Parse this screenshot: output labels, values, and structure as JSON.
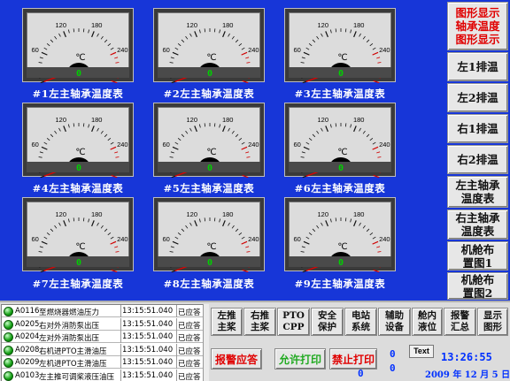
{
  "gauges": [
    {
      "label": "#1左主轴承温度表",
      "value": "0",
      "unit": "℃"
    },
    {
      "label": "#2左主轴承温度表",
      "value": "0",
      "unit": "℃"
    },
    {
      "label": "#3左主轴承温度表",
      "value": "0",
      "unit": "℃"
    },
    {
      "label": "#4左主轴承温度表",
      "value": "0",
      "unit": "℃"
    },
    {
      "label": "#5左主轴承温度表",
      "value": "0",
      "unit": "℃"
    },
    {
      "label": "#6左主轴承温度表",
      "value": "0",
      "unit": "℃"
    },
    {
      "label": "#7左主轴承温度表",
      "value": "0",
      "unit": "℃"
    },
    {
      "label": "#8左主轴承温度表",
      "value": "0",
      "unit": "℃"
    },
    {
      "label": "#9左主轴承温度表",
      "value": "0",
      "unit": "℃"
    }
  ],
  "gauge_scale": {
    "min": 0,
    "max": 300,
    "ticks": [
      "0",
      "60",
      "120",
      "180",
      "240",
      "300"
    ]
  },
  "nav": {
    "title_line1": "图形显示",
    "title_line2": "轴承温度",
    "title_line3": "图形显示",
    "items": [
      "左1排温",
      "左2排温",
      "右1排温",
      "右2排温",
      "左主轴承温度表",
      "右主轴承温度表",
      "机舱布置图1",
      "机舱布置图2"
    ]
  },
  "alarms": [
    {
      "code": "A0116",
      "desc": "至燃烧器燃油压力",
      "time": "13:15:51.040",
      "ack": "已应答"
    },
    {
      "code": "A0205",
      "desc": "右对外消防泵出压",
      "time": "13:15:51.040",
      "ack": "已应答"
    },
    {
      "code": "A0204",
      "desc": "左对外消防泵出压",
      "time": "13:15:51.040",
      "ack": "已应答"
    },
    {
      "code": "A0208",
      "desc": "右机进PTO主滑油压",
      "time": "13:15:51.040",
      "ack": "已应答"
    },
    {
      "code": "A0209",
      "desc": "左机进PTO主滑油压",
      "time": "13:15:51.040",
      "ack": "已应答"
    },
    {
      "code": "A0103",
      "desc": "左主推可调桨液压油压",
      "time": "13:15:51.040",
      "ack": "已应答"
    }
  ],
  "function_buttons": [
    {
      "line1": "左推",
      "line2": "主桨"
    },
    {
      "line1": "右推",
      "line2": "主桨"
    },
    {
      "line1": "PTO",
      "line2": "CPP"
    },
    {
      "line1": "安全",
      "line2": "保护"
    },
    {
      "line1": "电站",
      "line2": "系统"
    },
    {
      "line1": "辅助",
      "line2": "设备"
    },
    {
      "line1": "舱内",
      "line2": "液位"
    },
    {
      "line1": "报警",
      "line2": "汇总"
    },
    {
      "line1": "显示",
      "line2": "图形"
    }
  ],
  "actions": {
    "alarm_ack": "报警应答",
    "allow_print": "允许打印",
    "forbid_print": "禁止打印",
    "count_a": "0",
    "count_b": "0",
    "count_c": "0",
    "text_button": "Text"
  },
  "status": {
    "time": "13:26:55",
    "date": "2009 年 12 月 5  日"
  },
  "colors": {
    "background": "#1736d8",
    "gauge_value": "#00d000",
    "nav_title": "#e00000",
    "status_text": "#0030ff"
  }
}
